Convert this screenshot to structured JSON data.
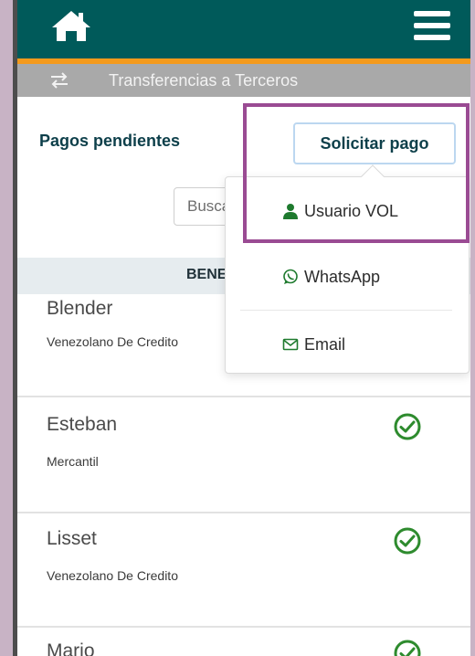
{
  "header": {
    "home_icon": "home-icon",
    "menu_icon": "hamburger-menu-icon"
  },
  "subheader": {
    "icon": "swap-arrows-icon",
    "title": "Transferencias a Terceros"
  },
  "section": {
    "title": "Pagos pendientes",
    "request_button": "Solicitar pago"
  },
  "search": {
    "placeholder": "Buscar"
  },
  "table": {
    "header": "BENEFICIARIO",
    "rows": [
      {
        "name": "Blender",
        "bank": "Venezolano De Credito"
      },
      {
        "name": "Esteban",
        "bank": "Mercantil",
        "status_icon": "check-circle-icon"
      },
      {
        "name": "Lisset",
        "bank": "Venezolano De Credito",
        "status_icon": "check-circle-icon"
      },
      {
        "name": "Mario",
        "status_icon": "check-circle-icon"
      }
    ]
  },
  "dropdown": {
    "items": [
      {
        "label": "Usuario VOL",
        "icon": "user-icon"
      },
      {
        "label": "WhatsApp",
        "icon": "whatsapp-icon"
      },
      {
        "label": "Email",
        "icon": "envelope-icon"
      }
    ]
  },
  "colors": {
    "header_bg": "#005a5a",
    "accent_orange": "#f49a1c",
    "subheader_bg": "#a9a9a9",
    "check_green": "#2e8b2e",
    "highlight_border": "#9a4b93"
  }
}
